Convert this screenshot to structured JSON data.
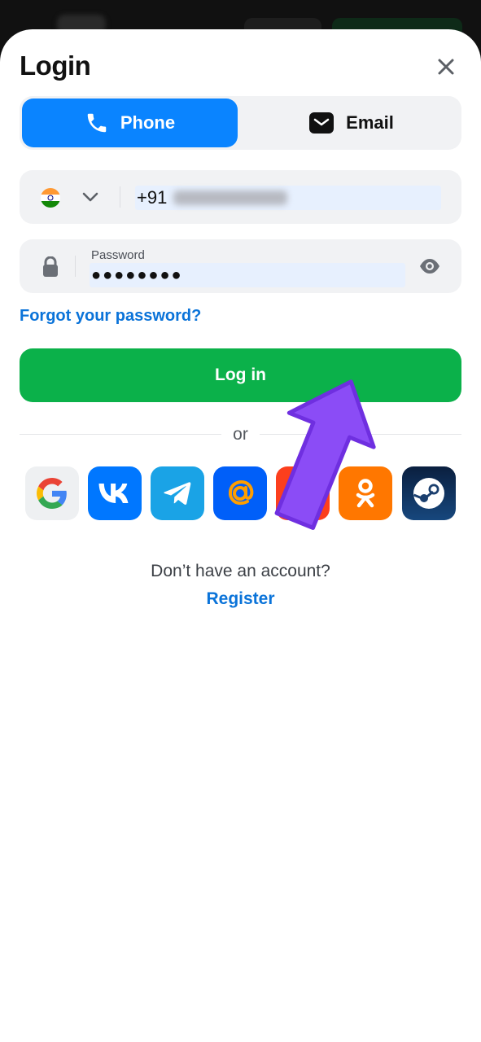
{
  "header": {
    "title": "Login"
  },
  "tabs": [
    {
      "label": "Phone",
      "active": true,
      "icon": "phone-icon"
    },
    {
      "label": "Email",
      "active": false,
      "icon": "envelope-icon"
    }
  ],
  "phone": {
    "country_flag": "india-flag-icon",
    "country_code": "+91"
  },
  "password": {
    "label": "Password",
    "value": "●●●●●●●●"
  },
  "forgot_link": "Forgot your password?",
  "login_button": "Log in",
  "divider_text": "or",
  "social": [
    {
      "name": "google",
      "color": "#eef0f2"
    },
    {
      "name": "vk",
      "color": "#0077ff"
    },
    {
      "name": "telegram",
      "color": "#1aa3e6"
    },
    {
      "name": "mail-ru",
      "color": "#005ff9"
    },
    {
      "name": "yandex",
      "color": "#fc3f1d"
    },
    {
      "name": "odnoklassniki",
      "color": "#ff7700"
    },
    {
      "name": "steam",
      "color": "#17477d"
    }
  ],
  "footer": {
    "no_account": "Don’t have an account?",
    "register": "Register"
  },
  "colors": {
    "accent": "#0a84ff",
    "primary_button": "#0bb14a",
    "link": "#0a73d9",
    "annotation_arrow": "#8b4cf6"
  }
}
